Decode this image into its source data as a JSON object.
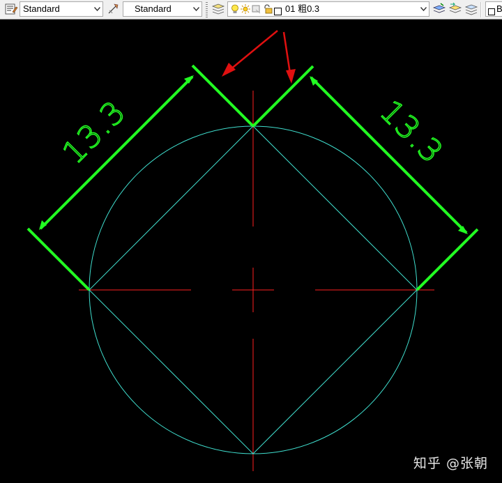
{
  "toolbar": {
    "text_style": "Standard",
    "dim_style": "Standard",
    "layer_display": "01 粗0.3",
    "layer_number": "01",
    "layer_name": "粗0.3",
    "partial_right": "B"
  },
  "drawing": {
    "dim_left": "13.3",
    "dim_right": "13.3"
  },
  "colors": {
    "background": "#000000",
    "dimension": "#22ff22",
    "geometry": "#40e0d0",
    "centerline": "#ff2020",
    "arrow_annotation": "#e01010"
  },
  "watermark": {
    "brand": "知乎",
    "author": "@张朝"
  }
}
